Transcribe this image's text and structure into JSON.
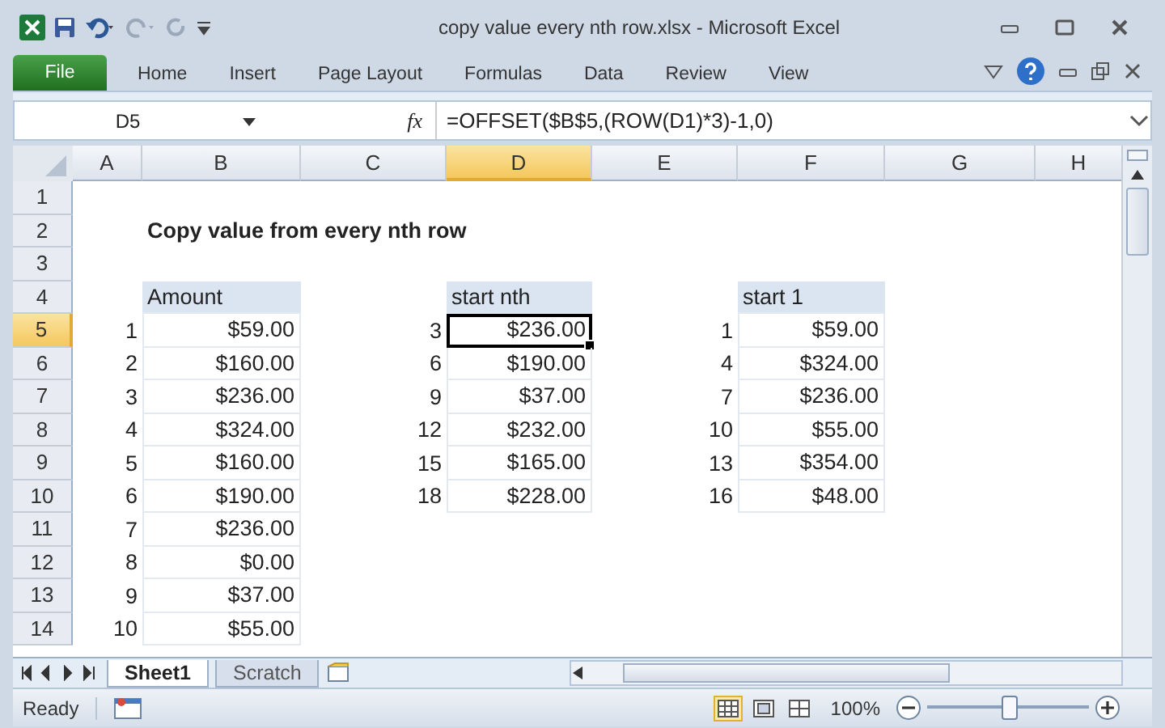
{
  "window": {
    "title": "copy value every nth row.xlsx  -  Microsoft Excel"
  },
  "ribbon_tabs": [
    {
      "label": "File",
      "kind": "file",
      "selected": false
    },
    {
      "label": "Home",
      "kind": "tab",
      "selected": false
    },
    {
      "label": "Insert",
      "kind": "tab",
      "selected": false
    },
    {
      "label": "Page Layout",
      "kind": "tab",
      "selected": false
    },
    {
      "label": "Formulas",
      "kind": "tab",
      "selected": false
    },
    {
      "label": "Data",
      "kind": "tab",
      "selected": false
    },
    {
      "label": "Review",
      "kind": "tab",
      "selected": false
    },
    {
      "label": "View",
      "kind": "tab",
      "selected": false
    }
  ],
  "formula_bar": {
    "name_box": "D5",
    "fx": "fx",
    "formula": "=OFFSET($B$5,(ROW(D1)*3)-1,0)"
  },
  "columns": [
    {
      "label": "A",
      "selected": false
    },
    {
      "label": "B",
      "selected": false
    },
    {
      "label": "C",
      "selected": false
    },
    {
      "label": "D",
      "selected": true
    },
    {
      "label": "E",
      "selected": false
    },
    {
      "label": "F",
      "selected": false
    },
    {
      "label": "G",
      "selected": false
    },
    {
      "label": "H",
      "selected": false
    }
  ],
  "rows": [
    {
      "header": "1",
      "selected": false,
      "cells": []
    },
    {
      "header": "2",
      "selected": false,
      "cells": [
        null,
        {
          "text": "Copy value from every nth row",
          "kind": "title",
          "selected": false
        }
      ]
    },
    {
      "header": "3",
      "selected": false,
      "cells": []
    },
    {
      "header": "4",
      "selected": false,
      "cells": [
        null,
        {
          "text": "Amount",
          "kind": "header",
          "selected": false
        },
        null,
        {
          "text": "start nth",
          "kind": "header",
          "selected": false
        },
        null,
        {
          "text": "start 1",
          "kind": "header",
          "selected": false
        }
      ]
    },
    {
      "header": "5",
      "selected": true,
      "cells": [
        {
          "text": "1",
          "kind": "number",
          "selected": false
        },
        {
          "text": "$59.00",
          "kind": "value",
          "selected": false
        },
        {
          "text": "3",
          "kind": "number",
          "selected": false
        },
        {
          "text": "$236.00",
          "kind": "value",
          "selected": true
        },
        {
          "text": "1",
          "kind": "number",
          "selected": false
        },
        {
          "text": "$59.00",
          "kind": "value",
          "selected": false
        }
      ]
    },
    {
      "header": "6",
      "selected": false,
      "cells": [
        {
          "text": "2",
          "kind": "number",
          "selected": false
        },
        {
          "text": "$160.00",
          "kind": "value",
          "selected": false
        },
        {
          "text": "6",
          "kind": "number",
          "selected": false
        },
        {
          "text": "$190.00",
          "kind": "value",
          "selected": false
        },
        {
          "text": "4",
          "kind": "number",
          "selected": false
        },
        {
          "text": "$324.00",
          "kind": "value",
          "selected": false
        }
      ]
    },
    {
      "header": "7",
      "selected": false,
      "cells": [
        {
          "text": "3",
          "kind": "number",
          "selected": false
        },
        {
          "text": "$236.00",
          "kind": "value",
          "selected": false
        },
        {
          "text": "9",
          "kind": "number",
          "selected": false
        },
        {
          "text": "$37.00",
          "kind": "value",
          "selected": false
        },
        {
          "text": "7",
          "kind": "number",
          "selected": false
        },
        {
          "text": "$236.00",
          "kind": "value",
          "selected": false
        }
      ]
    },
    {
      "header": "8",
      "selected": false,
      "cells": [
        {
          "text": "4",
          "kind": "number",
          "selected": false
        },
        {
          "text": "$324.00",
          "kind": "value",
          "selected": false
        },
        {
          "text": "12",
          "kind": "number",
          "selected": false
        },
        {
          "text": "$232.00",
          "kind": "value",
          "selected": false
        },
        {
          "text": "10",
          "kind": "number",
          "selected": false
        },
        {
          "text": "$55.00",
          "kind": "value",
          "selected": false
        }
      ]
    },
    {
      "header": "9",
      "selected": false,
      "cells": [
        {
          "text": "5",
          "kind": "number",
          "selected": false
        },
        {
          "text": "$160.00",
          "kind": "value",
          "selected": false
        },
        {
          "text": "15",
          "kind": "number",
          "selected": false
        },
        {
          "text": "$165.00",
          "kind": "value",
          "selected": false
        },
        {
          "text": "13",
          "kind": "number",
          "selected": false
        },
        {
          "text": "$354.00",
          "kind": "value",
          "selected": false
        }
      ]
    },
    {
      "header": "10",
      "selected": false,
      "cells": [
        {
          "text": "6",
          "kind": "number",
          "selected": false
        },
        {
          "text": "$190.00",
          "kind": "value",
          "selected": false
        },
        {
          "text": "18",
          "kind": "number",
          "selected": false
        },
        {
          "text": "$228.00",
          "kind": "value",
          "selected": false
        },
        {
          "text": "16",
          "kind": "number",
          "selected": false
        },
        {
          "text": "$48.00",
          "kind": "value",
          "selected": false
        }
      ]
    },
    {
      "header": "11",
      "selected": false,
      "cells": [
        {
          "text": "7",
          "kind": "number",
          "selected": false
        },
        {
          "text": "$236.00",
          "kind": "value",
          "selected": false
        }
      ]
    },
    {
      "header": "12",
      "selected": false,
      "cells": [
        {
          "text": "8",
          "kind": "number",
          "selected": false
        },
        {
          "text": "$0.00",
          "kind": "value",
          "selected": false
        }
      ]
    },
    {
      "header": "13",
      "selected": false,
      "cells": [
        {
          "text": "9",
          "kind": "number",
          "selected": false
        },
        {
          "text": "$37.00",
          "kind": "value",
          "selected": false
        }
      ]
    },
    {
      "header": "14",
      "selected": false,
      "cells": [
        {
          "text": "10",
          "kind": "number",
          "selected": false
        },
        {
          "text": "$55.00",
          "kind": "value",
          "selected": false
        }
      ]
    }
  ],
  "sheet_tabs": [
    {
      "label": "Sheet1",
      "selected": true
    },
    {
      "label": "Scratch",
      "selected": false
    }
  ],
  "status_bar": {
    "status": "Ready",
    "zoom": "100%",
    "zoom_slider": {
      "level": 0.5
    },
    "views": [
      {
        "kind": "normal",
        "selected": true
      },
      {
        "kind": "layout",
        "selected": false
      },
      {
        "kind": "break",
        "selected": false
      }
    ]
  }
}
